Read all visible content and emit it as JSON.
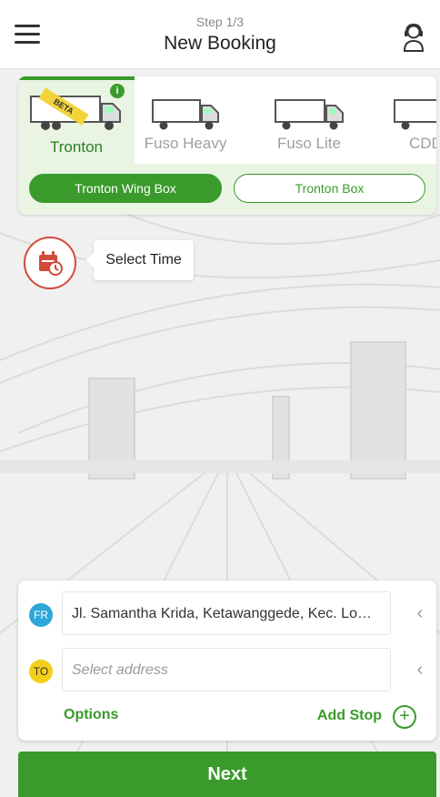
{
  "header": {
    "step": "Step 1/3",
    "title": "New Booking",
    "menu_icon": "hamburger-icon",
    "support_icon": "customer-support-icon"
  },
  "vehicles": {
    "items": [
      {
        "label": "Tronton",
        "selected": true,
        "badge": "BETA"
      },
      {
        "label": "Fuso Heavy",
        "selected": false
      },
      {
        "label": "Fuso Lite",
        "selected": false
      },
      {
        "label": "CDD",
        "selected": false
      }
    ],
    "info_icon": "i",
    "subtypes": [
      {
        "label": "Tronton Wing Box",
        "active": true
      },
      {
        "label": "Tronton Box",
        "active": false
      }
    ]
  },
  "schedule": {
    "label": "Select Time",
    "icon": "calendar-clock-icon"
  },
  "route": {
    "from_badge": "FR",
    "from_value": "Jl. Samantha Krida, Ketawanggede, Kec. Lowokwaru",
    "to_badge": "TO",
    "to_placeholder": "Select address",
    "options_label": "Options",
    "add_stop_label": "Add Stop",
    "add_stop_icon": "+"
  },
  "footer": {
    "next_label": "Next"
  },
  "colors": {
    "primary": "#3a9a2b",
    "from_badge": "#2ea6d8",
    "to_badge": "#f4cf1a",
    "time_icon": "#d24a3a"
  }
}
